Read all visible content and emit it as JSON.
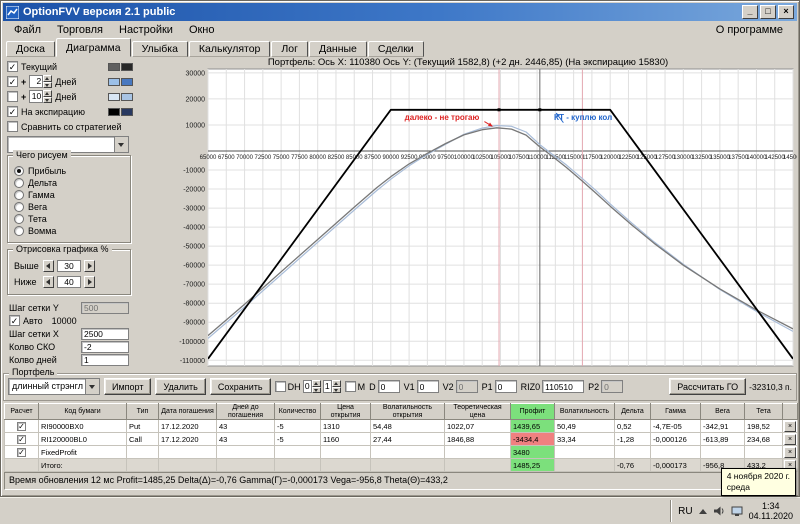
{
  "window": {
    "title": "OptionFVV версия 2.1 public",
    "menu": [
      "Файл",
      "Торговля",
      "Настройки",
      "Окно"
    ],
    "menu_right": "О программе",
    "controls": [
      {
        "name": "minimize-button",
        "glyph": "_"
      },
      {
        "name": "maximize-button",
        "glyph": "□"
      },
      {
        "name": "close-button",
        "glyph": "×"
      }
    ]
  },
  "tabs": {
    "items": [
      "Доска",
      "Диаграмма",
      "Улыбка",
      "Калькулятор",
      "Лог",
      "Данные",
      "Сделки"
    ],
    "active": "Диаграмма"
  },
  "sidebar": {
    "legend_rows": [
      {
        "label": "Текущий",
        "checked": true,
        "swatches": [
          "#606060",
          "#282828"
        ]
      },
      {
        "label": "Дней",
        "plus": "+",
        "spin": "2",
        "checked": true,
        "swatches": [
          "#9cc0e8",
          "#4878c0"
        ]
      },
      {
        "label": "Дней",
        "plus": "+",
        "spin": "10",
        "checked": false,
        "swatches": [
          "#d8e6f4",
          "#a8c4e4"
        ]
      },
      {
        "label": "На экспирацию",
        "checked": true,
        "swatches": [
          "#000000",
          "#283860"
        ]
      },
      {
        "label": "Сравнить со стратегией",
        "checked": false,
        "swatches": []
      }
    ],
    "strategy_combo_value": "",
    "draw_group": {
      "title": "Чего рисуем",
      "options": [
        "Прибыль",
        "Дельта",
        "Гамма",
        "Вега",
        "Тета",
        "Вомма"
      ],
      "selected": "Прибыль"
    },
    "render_group": {
      "title": "Отрисовка графика %",
      "rows": [
        {
          "label": "Выше",
          "value": "30"
        },
        {
          "label": "Ниже",
          "value": "40"
        }
      ]
    },
    "fields": [
      {
        "label": "Шаг сетки Y",
        "value": "500",
        "kind": "disabled"
      },
      {
        "label": "Авто",
        "value": "10000",
        "kind": "check",
        "checked": true
      },
      {
        "label": "Шаг сетки X",
        "value": "2500",
        "kind": "input"
      },
      {
        "label": "Колво СКО",
        "value": "-2",
        "kind": "input"
      },
      {
        "label": "Колво дней",
        "value": "1",
        "kind": "input"
      }
    ]
  },
  "chart_data": {
    "type": "line",
    "title": "Портфель: Ось X: 110380 Ось Y:  (Текущий 1582,8)  (+2 дн. 2446,85)  (На экспирацию 15830)",
    "x_min": 65000,
    "x_max": 145000,
    "x_step": 2500,
    "y_pos_ticks": [
      10000,
      20000,
      30000
    ],
    "y_neg_ticks": [
      -10000,
      -20000,
      -30000,
      -40000,
      -50000,
      -60000,
      -70000,
      -80000,
      -90000,
      -100000,
      -110000
    ],
    "y_pos_max": 31500,
    "y_neg_min": -113000,
    "series": [
      {
        "name": "+2 дней",
        "color": "#a8bcd8",
        "width": 1.2,
        "points": [
          [
            65000,
            -98500
          ],
          [
            70000,
            -82000
          ],
          [
            75000,
            -65000
          ],
          [
            80000,
            -48000
          ],
          [
            85000,
            -31000
          ],
          [
            88000,
            -21000
          ],
          [
            90000,
            -14800
          ],
          [
            92500,
            -7800
          ],
          [
            95000,
            -1800
          ],
          [
            97500,
            2600
          ],
          [
            100000,
            6400
          ],
          [
            102500,
            8800
          ],
          [
            104500,
            9800
          ],
          [
            106500,
            9500
          ],
          [
            108500,
            7300
          ],
          [
            110380,
            2447
          ],
          [
            112000,
            -1500
          ],
          [
            114000,
            -7300
          ],
          [
            116000,
            -13800
          ],
          [
            118000,
            -20600
          ],
          [
            120000,
            -27800
          ],
          [
            123000,
            -38000
          ],
          [
            126000,
            -47800
          ],
          [
            130000,
            -59500
          ],
          [
            135000,
            -72800
          ],
          [
            140000,
            -84300
          ],
          [
            145000,
            -94800
          ]
        ]
      },
      {
        "name": "Текущий",
        "color": "#787878",
        "width": 1.3,
        "points": [
          [
            65000,
            -97000
          ],
          [
            70000,
            -80500
          ],
          [
            75000,
            -63500
          ],
          [
            80000,
            -46500
          ],
          [
            85000,
            -29500
          ],
          [
            88000,
            -19500
          ],
          [
            90000,
            -13500
          ],
          [
            92500,
            -6800
          ],
          [
            95000,
            -1200
          ],
          [
            97500,
            2900
          ],
          [
            100000,
            6200
          ],
          [
            102500,
            8200
          ],
          [
            104500,
            8900
          ],
          [
            106500,
            8400
          ],
          [
            108500,
            6100
          ],
          [
            110380,
            1583
          ],
          [
            112000,
            -2600
          ],
          [
            114000,
            -8600
          ],
          [
            116000,
            -15200
          ],
          [
            118000,
            -22000
          ],
          [
            120000,
            -29000
          ],
          [
            123000,
            -39000
          ],
          [
            126000,
            -48500
          ],
          [
            130000,
            -60000
          ],
          [
            135000,
            -72500
          ],
          [
            140000,
            -83500
          ],
          [
            145000,
            -93500
          ]
        ]
      },
      {
        "name": "На экспирацию",
        "color": "#000000",
        "width": 1.8,
        "points": [
          [
            65000,
            -109200
          ],
          [
            90000,
            15830
          ],
          [
            120000,
            15830
          ],
          [
            145000,
            -109200
          ]
        ]
      }
    ],
    "vlines": [
      {
        "x": 104800,
        "color": "#e4a8b0"
      },
      {
        "x": 110380,
        "color": "#6a6a6a"
      },
      {
        "x": 116200,
        "color": "#e4a8b0"
      }
    ],
    "markers": [
      {
        "x": 104800,
        "y": 15830
      },
      {
        "x": 110380,
        "y": 15830
      }
    ],
    "annotations": [
      {
        "text": "далеко - не трогаю",
        "x": 97000,
        "y": 12000,
        "color": "#dd2222",
        "arrow": {
          "x1": 102800,
          "y1": 11300,
          "x2": 103900,
          "y2": 9500
        }
      },
      {
        "text": "КТ - куплю кол",
        "x": 116300,
        "y": 12000,
        "color": "#2266cc",
        "arrow": {
          "x1": 113600,
          "y1": 10900,
          "x2": 112600,
          "y2": 14600
        }
      }
    ]
  },
  "portfolio": {
    "group_label": "Портфель",
    "combo_value": "длинный стрэнгл",
    "buttons": [
      "Импорт",
      "Удалить",
      "Сохранить"
    ],
    "dh": {
      "label": "DH",
      "checked": false,
      "values": [
        "0",
        "1"
      ]
    },
    "m": {
      "label": "M",
      "checked": false
    },
    "fields": [
      {
        "label": "D",
        "value": "0"
      },
      {
        "label": "V1",
        "value": "0"
      },
      {
        "label": "V2",
        "value": "0",
        "disabled": true
      },
      {
        "label": "P1",
        "value": "0"
      },
      {
        "label": "RIZ0",
        "value": "110510",
        "wide": true
      },
      {
        "label": "P2",
        "value": "0",
        "disabled": true
      }
    ],
    "calc_button": "Рассчитать ГО",
    "calc_value": "-32310,3 п."
  },
  "table": {
    "columns": [
      "Расчет",
      "Код бумаги",
      "Тип",
      "Дата погашения",
      "Дней до погашения",
      "Количество",
      "Цена открытия",
      "Волатильность открытия",
      "Теоретическая цена",
      "Профит",
      "Волатильность",
      "Дельта",
      "Гамма",
      "Вега",
      "Тета",
      ""
    ],
    "rows": [
      {
        "checked": true,
        "profit_color": "green",
        "cells": [
          "RI90000BX0",
          "Put",
          "17.12.2020",
          "43",
          "-5",
          "1310",
          "54,48",
          "1022,07",
          "1439,65",
          "50,49",
          "0,52",
          "-4,7E-05",
          "-342,91",
          "198,52"
        ]
      },
      {
        "checked": true,
        "profit_color": "red",
        "cells": [
          "RI120000BL0",
          "Call",
          "17.12.2020",
          "43",
          "-5",
          "1160",
          "27,44",
          "1846,88",
          "-3434,4",
          "33,34",
          "-1,28",
          "-0,000126",
          "-613,89",
          "234,68"
        ]
      },
      {
        "checked": true,
        "profit_color": "green",
        "cells": [
          "FixedProfit",
          "",
          "",
          "",
          "",
          "",
          "",
          "",
          "3480",
          "",
          "",
          "",
          "",
          ""
        ]
      },
      {
        "checked": null,
        "total": true,
        "profit_color": "green",
        "cells": [
          "Итого:",
          "",
          "",
          "",
          "",
          "",
          "",
          "",
          "1485,25",
          "",
          "-0,76",
          "-0,000173",
          "-956,8",
          "433,2"
        ]
      }
    ]
  },
  "statusbar": {
    "text": "Время обновления 12 мс  Profit=1485,25 Delta(Δ)=-0,76 Gamma(Γ)=-0,000173 Vega=-956,8 Theta(Θ)=433,2"
  },
  "tooltip": {
    "line1": "4 ноября 2020 г.",
    "line2": "среда"
  },
  "tray": {
    "lang": "RU",
    "time": "1:34",
    "date": "04.11.2020"
  }
}
